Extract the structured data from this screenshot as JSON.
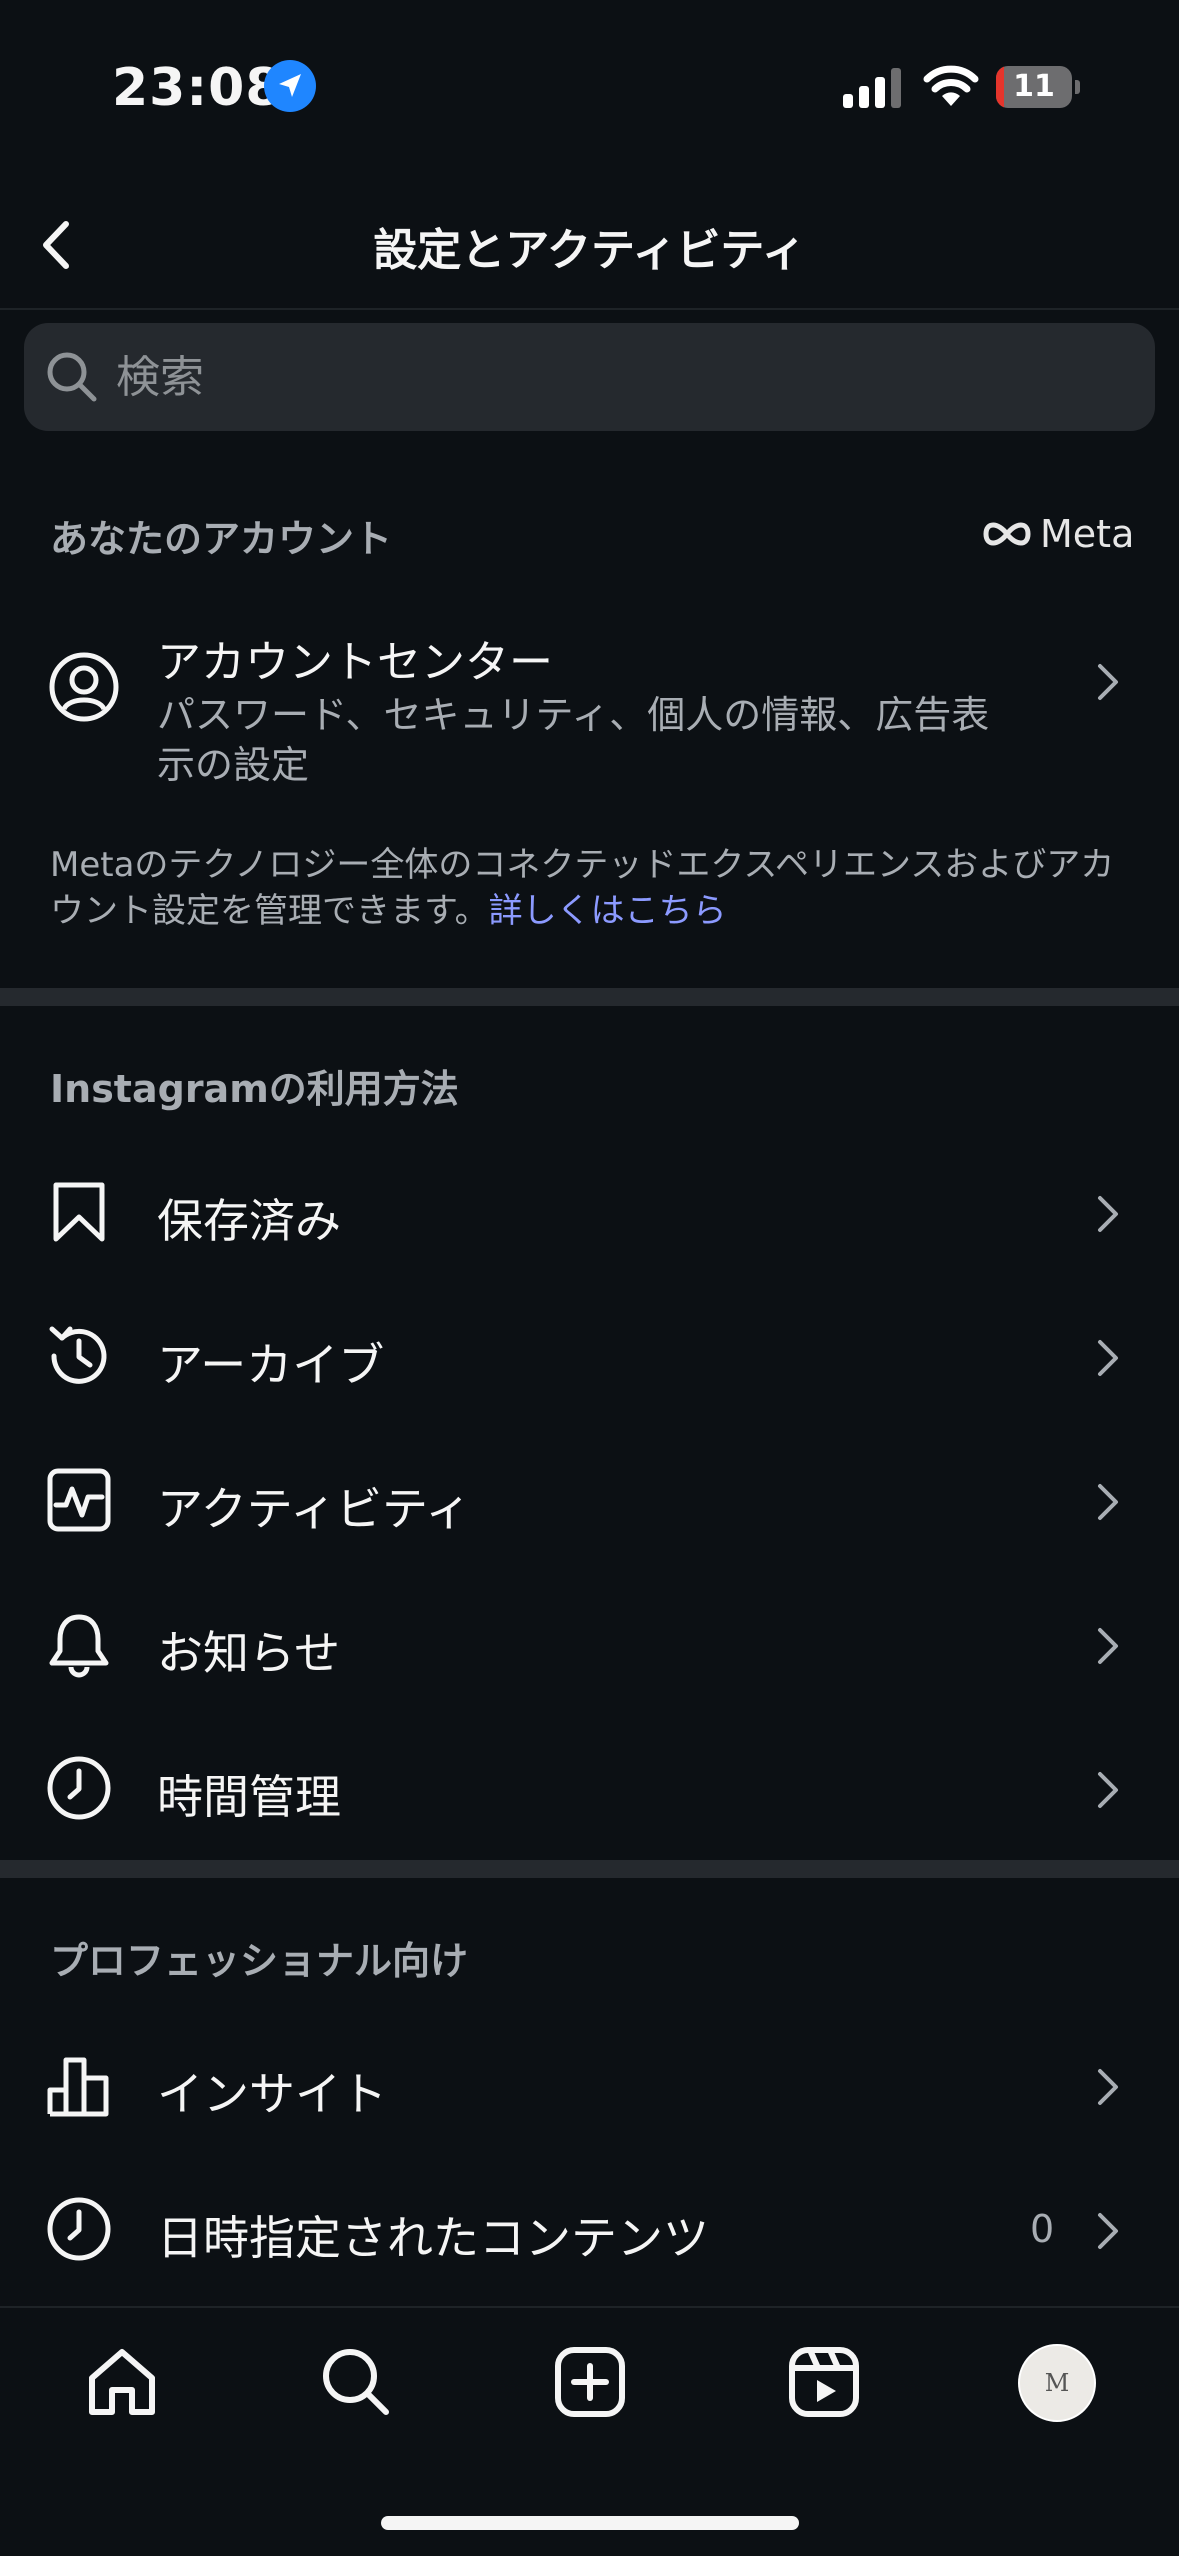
{
  "status_bar": {
    "time": "23:08",
    "battery_level": "11",
    "battery_percent": 11
  },
  "header": {
    "title": "設定とアクティビティ",
    "back_icon": "chevron-left-icon"
  },
  "search": {
    "placeholder": "検索",
    "value": ""
  },
  "account_section": {
    "heading": "あなたのアカウント",
    "meta_logo": "Meta",
    "item": {
      "title": "アカウントセンター",
      "subtitle": "パスワード、セキュリティ、個人の情報、広告表示の設定",
      "icon": "user-circle-icon"
    },
    "description": "Metaのテクノロジー全体のコネクテッドエクスペリエンスおよびアカウント設定を管理できます。",
    "link": "詳しくはこちら"
  },
  "usage_section": {
    "heading": "Instagramの利用方法",
    "items": [
      {
        "label": "保存済み",
        "icon": "bookmark-icon"
      },
      {
        "label": "アーカイブ",
        "icon": "archive-history-icon"
      },
      {
        "label": "アクティビティ",
        "icon": "activity-icon"
      },
      {
        "label": "お知らせ",
        "icon": "bell-icon"
      },
      {
        "label": "時間管理",
        "icon": "clock-icon"
      }
    ]
  },
  "pro_section": {
    "heading": "プロフェッショナル向け",
    "items": [
      {
        "label": "インサイト",
        "icon": "bar-chart-icon"
      },
      {
        "label": "日時指定されたコンテンツ",
        "icon": "clock-icon",
        "count": "0"
      }
    ]
  },
  "tab_bar": {
    "tabs": [
      "home-icon",
      "search-icon",
      "create-icon",
      "reels-icon",
      "profile-avatar"
    ],
    "avatar_initial": "M"
  },
  "colors": {
    "background": "#0c1014",
    "secondary_text": "#a8adb3",
    "link": "#8c9aff",
    "battery_low": "#e5352c"
  }
}
